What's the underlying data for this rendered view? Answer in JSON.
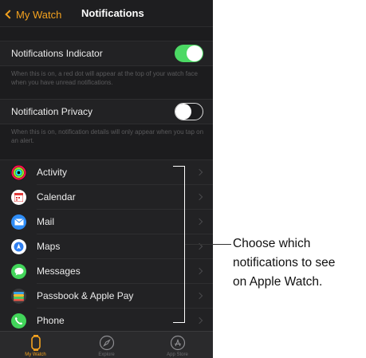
{
  "navbar": {
    "back_label": "My Watch",
    "title": "Notifications"
  },
  "settings": [
    {
      "label": "Notifications Indicator",
      "toggle_on": true,
      "footnote": "When this is on, a red dot will appear at the top of your watch face when you have unread notifications."
    },
    {
      "label": "Notification Privacy",
      "toggle_on": false,
      "footnote": "When this is on, notification details will only appear when you tap on an alert."
    }
  ],
  "apps": [
    {
      "label": "Activity",
      "icon": "activity-rings-icon"
    },
    {
      "label": "Calendar",
      "icon": "calendar-icon"
    },
    {
      "label": "Mail",
      "icon": "mail-icon"
    },
    {
      "label": "Maps",
      "icon": "maps-icon"
    },
    {
      "label": "Messages",
      "icon": "messages-icon"
    },
    {
      "label": "Passbook & Apple Pay",
      "icon": "passbook-icon"
    },
    {
      "label": "Phone",
      "icon": "phone-icon"
    }
  ],
  "tabbar": [
    {
      "label": "My Watch",
      "icon": "watch-icon",
      "active": true
    },
    {
      "label": "Explore",
      "icon": "compass-icon",
      "active": false
    },
    {
      "label": "App Store",
      "icon": "app-store-icon",
      "active": false
    }
  ],
  "callout": {
    "lines": [
      "Choose which",
      "notifications to see",
      "on Apple Watch."
    ]
  },
  "colors": {
    "accent": "#f4a21f",
    "toggle_on": "#4cd964",
    "background": "#1c1c1e"
  }
}
